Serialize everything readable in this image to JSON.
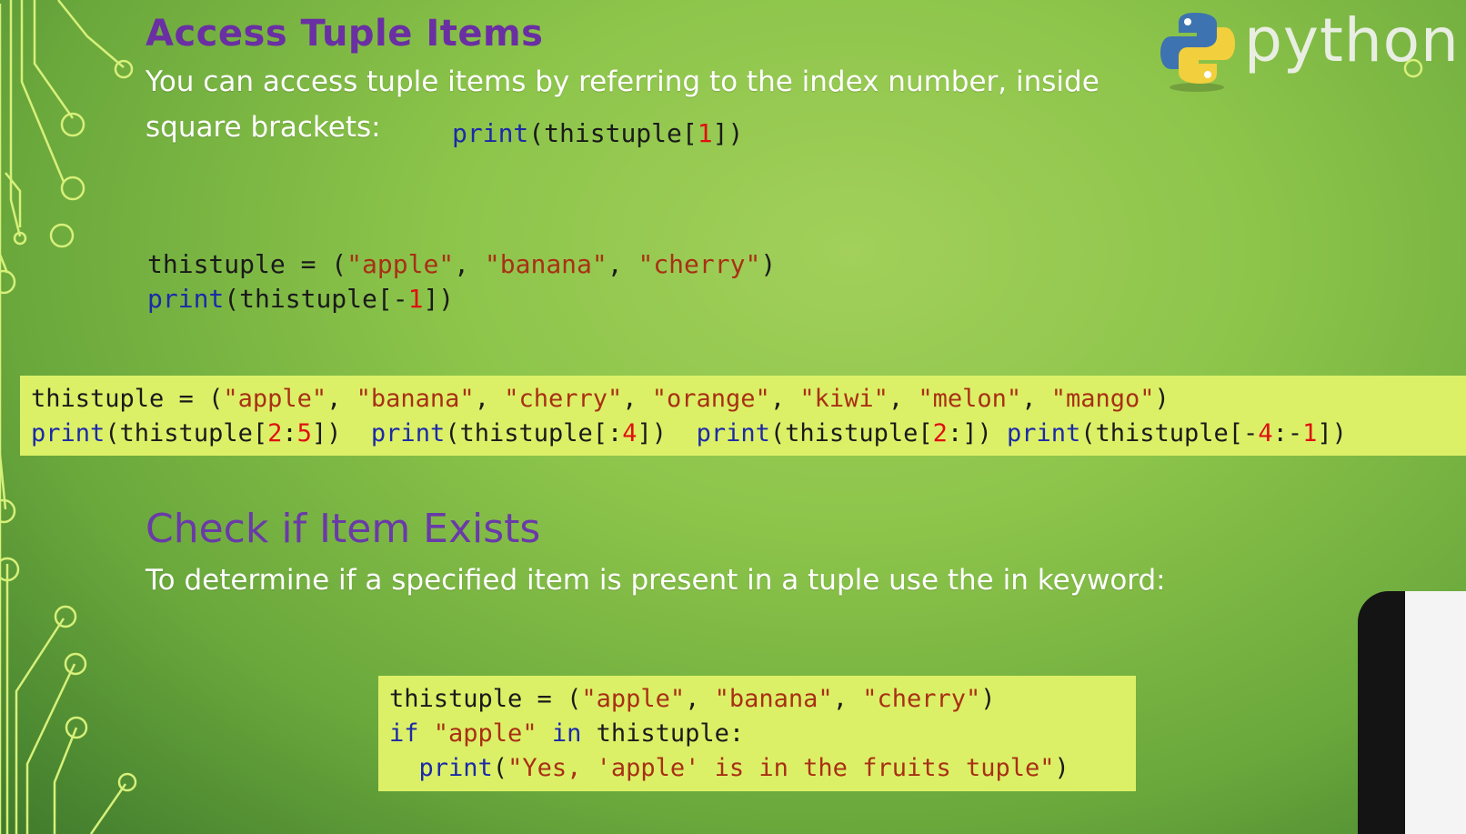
{
  "slide": {
    "title1": "Access Tuple Items",
    "text1_line1": "You can access tuple items by referring to the index number, inside",
    "text1_line2": "square brackets:",
    "title2": "Check if Item Exists",
    "text2": "To determine if a specified item is present in a tuple use the in keyword:"
  },
  "logo": {
    "text": "python",
    "icon": "python-logo-icon"
  },
  "code_inline": [
    {
      "t": "print",
      "c": "kw"
    },
    {
      "t": "(thistuple["
    },
    {
      "t": "1",
      "c": "num"
    },
    {
      "t": "])"
    }
  ],
  "code_block1": [
    [
      {
        "t": "thistuple = ("
      },
      {
        "t": "\"apple\"",
        "c": "str"
      },
      {
        "t": ", "
      },
      {
        "t": "\"banana\"",
        "c": "str"
      },
      {
        "t": ", "
      },
      {
        "t": "\"cherry\"",
        "c": "str"
      },
      {
        "t": ")"
      }
    ],
    [
      {
        "t": "print",
        "c": "kw"
      },
      {
        "t": "(thistuple[-"
      },
      {
        "t": "1",
        "c": "num"
      },
      {
        "t": "])"
      }
    ]
  ],
  "code_band": [
    [
      {
        "t": "thistuple = ("
      },
      {
        "t": "\"apple\"",
        "c": "str"
      },
      {
        "t": ", "
      },
      {
        "t": "\"banana\"",
        "c": "str"
      },
      {
        "t": ", "
      },
      {
        "t": "\"cherry\"",
        "c": "str"
      },
      {
        "t": ", "
      },
      {
        "t": "\"orange\"",
        "c": "str"
      },
      {
        "t": ", "
      },
      {
        "t": "\"kiwi\"",
        "c": "str"
      },
      {
        "t": ", "
      },
      {
        "t": "\"melon\"",
        "c": "str"
      },
      {
        "t": ", "
      },
      {
        "t": "\"mango\"",
        "c": "str"
      },
      {
        "t": ")"
      }
    ],
    [
      {
        "t": "print",
        "c": "kw"
      },
      {
        "t": "(thistuple["
      },
      {
        "t": "2",
        "c": "num"
      },
      {
        "t": ":"
      },
      {
        "t": "5",
        "c": "num"
      },
      {
        "t": "])  "
      },
      {
        "t": "print",
        "c": "kw"
      },
      {
        "t": "(thistuple[:"
      },
      {
        "t": "4",
        "c": "num"
      },
      {
        "t": "])  "
      },
      {
        "t": "print",
        "c": "kw"
      },
      {
        "t": "(thistuple["
      },
      {
        "t": "2",
        "c": "num"
      },
      {
        "t": ":]) "
      },
      {
        "t": "print",
        "c": "kw"
      },
      {
        "t": "(thistuple[-"
      },
      {
        "t": "4",
        "c": "num"
      },
      {
        "t": ":-"
      },
      {
        "t": "1",
        "c": "num"
      },
      {
        "t": "])"
      }
    ]
  ],
  "code_block2": [
    [
      {
        "t": "thistuple = ("
      },
      {
        "t": "\"apple\"",
        "c": "str"
      },
      {
        "t": ", "
      },
      {
        "t": "\"banana\"",
        "c": "str"
      },
      {
        "t": ", "
      },
      {
        "t": "\"cherry\"",
        "c": "str"
      },
      {
        "t": ")"
      }
    ],
    [
      {
        "t": "if",
        "c": "kw"
      },
      {
        "t": " "
      },
      {
        "t": "\"apple\"",
        "c": "str"
      },
      {
        "t": " "
      },
      {
        "t": "in",
        "c": "kw"
      },
      {
        "t": " thistuple:"
      }
    ],
    [
      {
        "t": "  "
      },
      {
        "t": "print",
        "c": "kw"
      },
      {
        "t": "("
      },
      {
        "t": "\"Yes, 'apple' is in the fruits tuple\"",
        "c": "str"
      },
      {
        "t": ")"
      }
    ]
  ]
}
